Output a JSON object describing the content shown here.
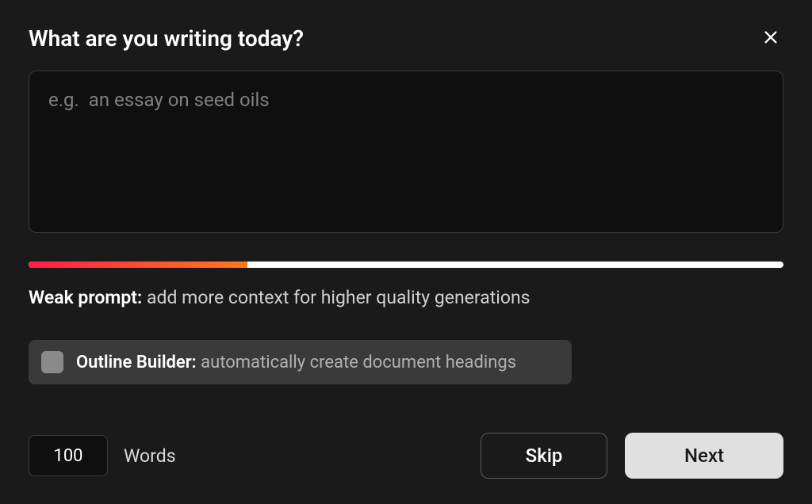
{
  "modal": {
    "title": "What are you writing today?",
    "prompt_placeholder": "e.g.  an essay on seed oils",
    "prompt_value": "",
    "strength": {
      "label": "Weak prompt:",
      "hint": "add more context for higher quality generations"
    },
    "outline": {
      "checked": false,
      "label": "Outline Builder:",
      "description": "automatically create document headings"
    },
    "words": {
      "value": "100",
      "label": "Words"
    },
    "buttons": {
      "skip": "Skip",
      "next": "Next"
    }
  }
}
